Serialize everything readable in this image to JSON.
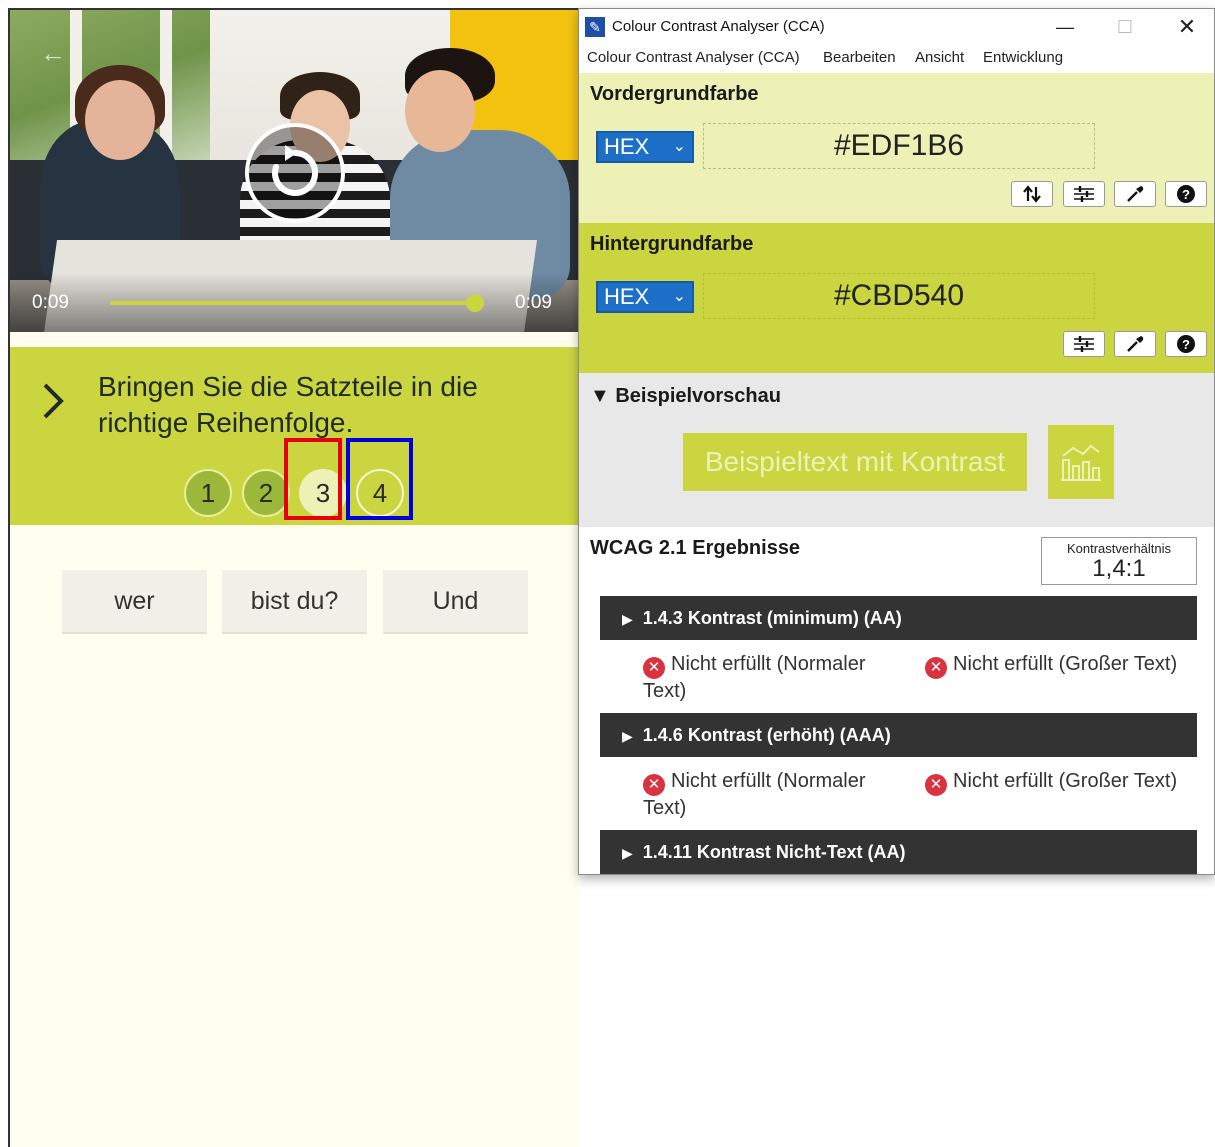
{
  "left_app": {
    "video": {
      "time_current": "0:09",
      "time_total": "0:09",
      "progress_fraction": 1.0
    },
    "task": {
      "instruction": "Bringen Sie die Satzteile in die richtige Reihenfolge.",
      "steps": [
        "1",
        "2",
        "3",
        "4"
      ],
      "current_step": "3"
    },
    "words": [
      "wer",
      "bist du?",
      "Und"
    ],
    "annotations": {
      "red_box_color": "#e3000f",
      "blue_box_color": "#0000e0"
    },
    "colors": {
      "panel": "#cbd540",
      "background": "#fffff0"
    }
  },
  "cca": {
    "window_title": "Colour Contrast Analyser (CCA)",
    "menu": [
      "Colour Contrast Analyser (CCA)",
      "Bearbeiten",
      "Ansicht",
      "Entwicklung"
    ],
    "foreground": {
      "heading": "Vordergrundfarbe",
      "format": "HEX",
      "value": "#EDF1B6"
    },
    "background": {
      "heading": "Hintergrundfarbe",
      "format": "HEX",
      "value": "#CBD540"
    },
    "preview": {
      "heading": "Beispielvorschau",
      "sample_text": "Beispieltext mit Kontrast"
    },
    "results": {
      "heading": "WCAG 2.1 Ergebnisse",
      "ratio_label": "Kontrastverhältnis",
      "ratio_value": "1,4:1",
      "criteria": [
        {
          "title": "1.4.3 Kontrast (minimum) (AA)",
          "normal": "Nicht erfüllt (Normaler Text)",
          "large": "Nicht erfüllt (Großer Text)"
        },
        {
          "title": "1.4.6 Kontrast (erhöht) (AAA)",
          "normal": "Nicht erfüllt (Normaler Text)",
          "large": "Nicht erfüllt (Großer Text)"
        },
        {
          "title": "1.4.11 Kontrast Nicht-Text (AA)"
        }
      ]
    },
    "icons": [
      "app-icon",
      "minimize-icon",
      "maximize-icon",
      "close-icon",
      "swap-icon",
      "sliders-icon",
      "eyedropper-icon",
      "help-icon",
      "chart-icon",
      "fail-x-icon"
    ]
  }
}
